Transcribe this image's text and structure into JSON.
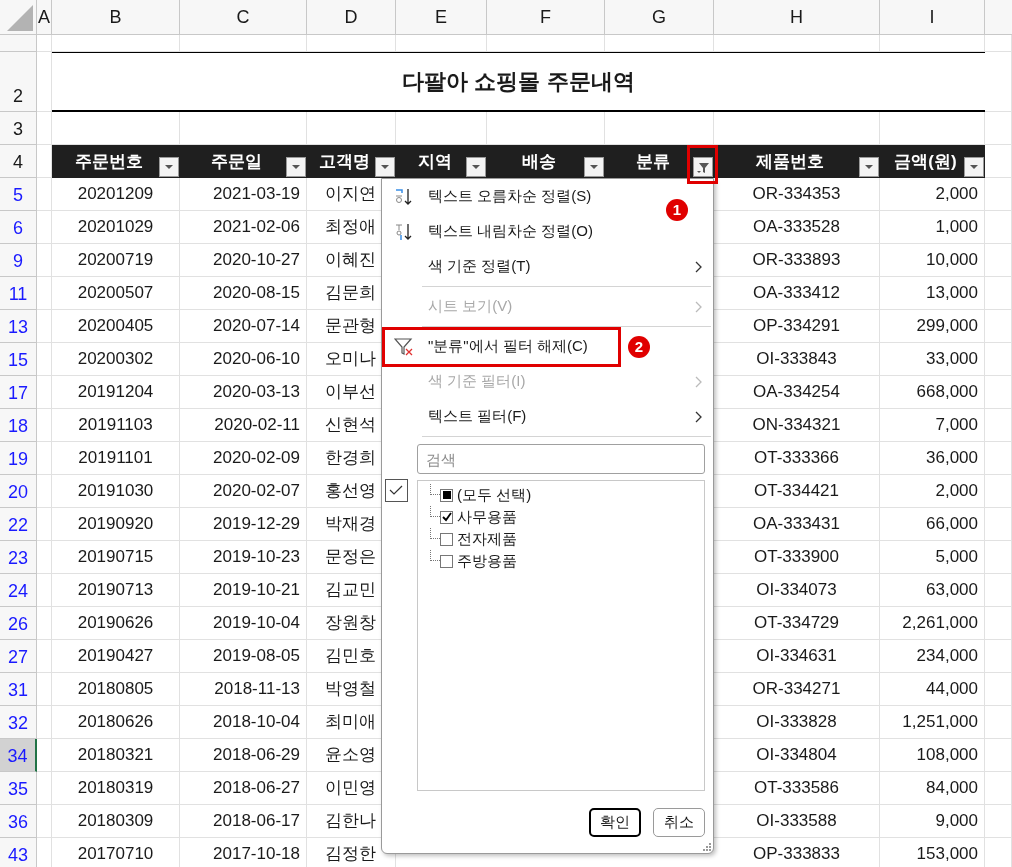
{
  "column_headers": [
    "A",
    "B",
    "C",
    "D",
    "E",
    "F",
    "G",
    "H",
    "I"
  ],
  "title": "다팔아 쇼핑몰 주문내역",
  "table_headers": [
    {
      "label": "주문번호",
      "filtered": false
    },
    {
      "label": "주문일",
      "filtered": false
    },
    {
      "label": "고객명",
      "filtered": false
    },
    {
      "label": "지역",
      "filtered": false
    },
    {
      "label": "배송",
      "filtered": false
    },
    {
      "label": "분류",
      "filtered": true,
      "callout": "1"
    },
    {
      "label": "제품번호",
      "filtered": false
    },
    {
      "label": "금액(원)",
      "filtered": false
    }
  ],
  "header_row_labels": [
    "2",
    "3",
    "4"
  ],
  "rows": [
    {
      "row": "5",
      "selected": false,
      "order_no": "20201209",
      "date": "2021-03-19",
      "customer": "이지연",
      "product_no": "OR-334353",
      "amount": "2,000"
    },
    {
      "row": "6",
      "selected": false,
      "order_no": "20201029",
      "date": "2021-02-06",
      "customer": "최정애",
      "product_no": "OA-333528",
      "amount": "1,000"
    },
    {
      "row": "9",
      "selected": false,
      "order_no": "20200719",
      "date": "2020-10-27",
      "customer": "이혜진",
      "product_no": "OR-333893",
      "amount": "10,000"
    },
    {
      "row": "11",
      "selected": false,
      "order_no": "20200507",
      "date": "2020-08-15",
      "customer": "김문희",
      "product_no": "OA-333412",
      "amount": "13,000"
    },
    {
      "row": "13",
      "selected": false,
      "order_no": "20200405",
      "date": "2020-07-14",
      "customer": "문관형",
      "product_no": "OP-334291",
      "amount": "299,000"
    },
    {
      "row": "15",
      "selected": false,
      "order_no": "20200302",
      "date": "2020-06-10",
      "customer": "오미나",
      "product_no": "OI-333843",
      "amount": "33,000"
    },
    {
      "row": "17",
      "selected": false,
      "order_no": "20191204",
      "date": "2020-03-13",
      "customer": "이부선",
      "product_no": "OA-334254",
      "amount": "668,000"
    },
    {
      "row": "18",
      "selected": false,
      "order_no": "20191103",
      "date": "2020-02-11",
      "customer": "신현석",
      "product_no": "ON-334321",
      "amount": "7,000"
    },
    {
      "row": "19",
      "selected": false,
      "order_no": "20191101",
      "date": "2020-02-09",
      "customer": "한경희",
      "product_no": "OT-333366",
      "amount": "36,000"
    },
    {
      "row": "20",
      "selected": false,
      "order_no": "20191030",
      "date": "2020-02-07",
      "customer": "홍선영",
      "product_no": "OT-334421",
      "amount": "2,000"
    },
    {
      "row": "22",
      "selected": false,
      "order_no": "20190920",
      "date": "2019-12-29",
      "customer": "박재경",
      "product_no": "OA-333431",
      "amount": "66,000"
    },
    {
      "row": "23",
      "selected": false,
      "order_no": "20190715",
      "date": "2019-10-23",
      "customer": "문정은",
      "product_no": "OT-333900",
      "amount": "5,000"
    },
    {
      "row": "24",
      "selected": false,
      "order_no": "20190713",
      "date": "2019-10-21",
      "customer": "김교민",
      "product_no": "OI-334073",
      "amount": "63,000"
    },
    {
      "row": "26",
      "selected": false,
      "order_no": "20190626",
      "date": "2019-10-04",
      "customer": "장원창",
      "product_no": "OT-334729",
      "amount": "2,261,000"
    },
    {
      "row": "27",
      "selected": false,
      "order_no": "20190427",
      "date": "2019-08-05",
      "customer": "김민호",
      "product_no": "OI-334631",
      "amount": "234,000"
    },
    {
      "row": "31",
      "selected": false,
      "order_no": "20180805",
      "date": "2018-11-13",
      "customer": "박영철",
      "product_no": "OR-334271",
      "amount": "44,000"
    },
    {
      "row": "32",
      "selected": false,
      "order_no": "20180626",
      "date": "2018-10-04",
      "customer": "최미애",
      "product_no": "OI-333828",
      "amount": "1,251,000"
    },
    {
      "row": "34",
      "selected": true,
      "order_no": "20180321",
      "date": "2018-06-29",
      "customer": "윤소영",
      "product_no": "OI-334804",
      "amount": "108,000"
    },
    {
      "row": "35",
      "selected": false,
      "order_no": "20180319",
      "date": "2018-06-27",
      "customer": "이민영",
      "product_no": "OT-333586",
      "amount": "84,000"
    },
    {
      "row": "36",
      "selected": false,
      "order_no": "20180309",
      "date": "2018-06-17",
      "customer": "김한나",
      "product_no": "OI-333588",
      "amount": "9,000"
    },
    {
      "row": "43",
      "selected": false,
      "order_no": "20170710",
      "date": "2017-10-18",
      "customer": "김정한",
      "product_no": "OP-333833",
      "amount": "153,000"
    }
  ],
  "filter_menu": {
    "items": [
      {
        "kind": "ascending",
        "label": "텍스트 오름차순 정렬(S)",
        "disabled": false,
        "submenu": false
      },
      {
        "kind": "descending",
        "label": "텍스트 내림차순 정렬(O)",
        "disabled": false,
        "submenu": false
      },
      {
        "kind": "item",
        "label": "색 기준 정렬(T)",
        "disabled": false,
        "submenu": true
      },
      {
        "kind": "separator"
      },
      {
        "kind": "item",
        "label": "시트 보기(V)",
        "disabled": true,
        "submenu": true
      },
      {
        "kind": "separator"
      },
      {
        "kind": "clearfilter",
        "label": "\"분류\"에서 필터 해제(C)",
        "disabled": false,
        "submenu": false,
        "callout": "2"
      },
      {
        "kind": "item",
        "label": "색 기준 필터(I)",
        "disabled": true,
        "submenu": true
      },
      {
        "kind": "item",
        "label": "텍스트 필터(F)",
        "disabled": false,
        "submenu": true
      },
      {
        "kind": "separator"
      }
    ],
    "search": {
      "placeholder": "검색"
    },
    "values": [
      {
        "label": "(모두 선택)",
        "indeterminate": true
      },
      {
        "label": "사무용품",
        "checked": true
      },
      {
        "label": "전자제품",
        "checked": false
      },
      {
        "label": "주방용품",
        "checked": false
      }
    ],
    "buttons": [
      {
        "label": "확인",
        "default": true
      },
      {
        "label": "취소",
        "default": false
      }
    ]
  }
}
